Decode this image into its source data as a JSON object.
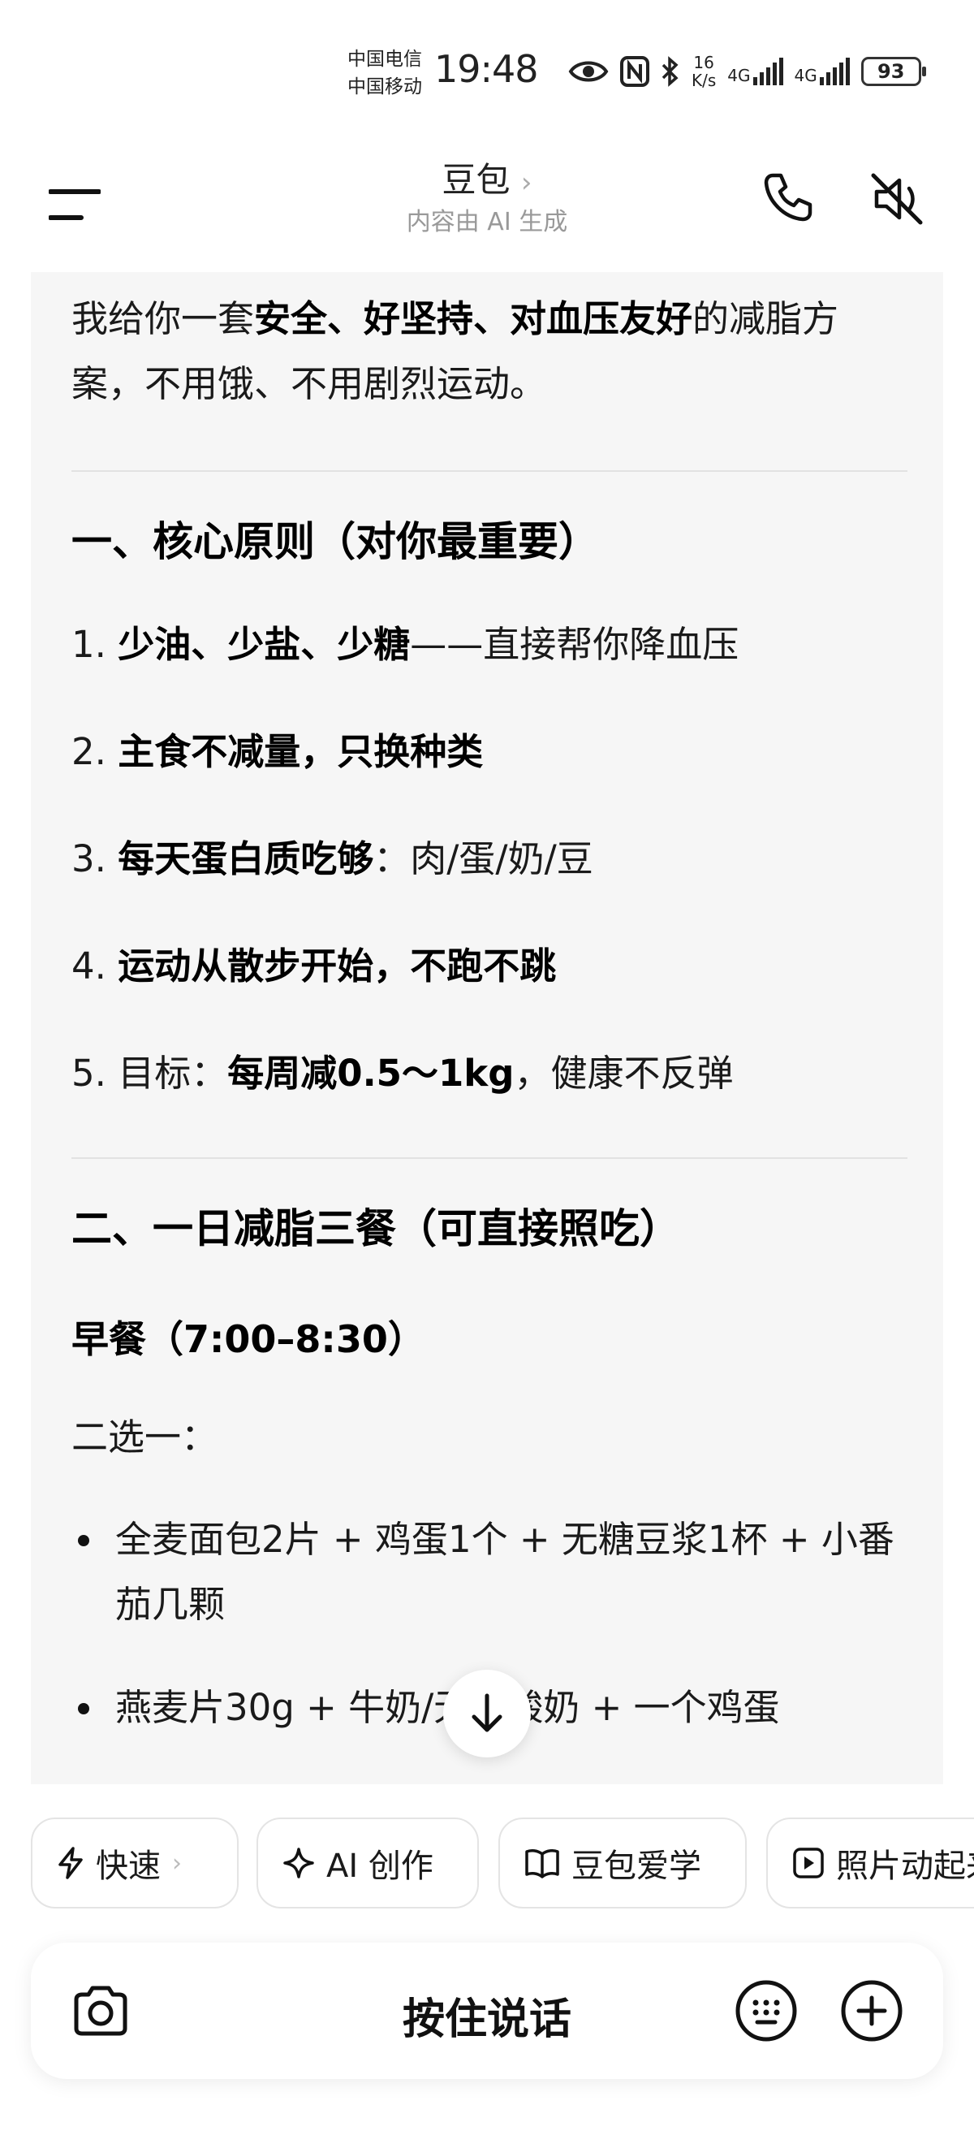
{
  "status_bar": {
    "carrier_1": "中国电信",
    "carrier_2": "中国移动",
    "time": "19:48",
    "speed_value": "16",
    "speed_unit": "K/s",
    "sim1_network": "4G",
    "sim2_network": "4G",
    "battery": "93"
  },
  "header": {
    "title": "豆包",
    "title_chevron": "›",
    "subtitle": "内容由 AI 生成"
  },
  "message": {
    "intro_a": "我给你一套",
    "intro_b": "安全、好坚持、对血压友好",
    "intro_c": "的减脂方案，不用饿、不用剧烈运动。",
    "section1_title": "一、核心原则（对你最重要）",
    "principles": [
      {
        "num": "1. ",
        "bold": "少油、少盐、少糖",
        "rest": "——直接帮你降血压"
      },
      {
        "num": "2. ",
        "bold": "主食不减量，只换种类",
        "rest": ""
      },
      {
        "num": "3. ",
        "bold": "每天蛋白质吃够",
        "rest": "：肉/蛋/奶/豆"
      },
      {
        "num": "4. ",
        "bold": "运动从散步开始，不跑不跳",
        "rest": ""
      },
      {
        "num": "5. ",
        "pre": "目标：",
        "bold": "每周减0.5～1kg",
        "rest": "，健康不反弹"
      }
    ],
    "section2_title": "二、一日减脂三餐（可直接照吃）",
    "breakfast_title": "早餐（7:00–8:30）",
    "choose_one": "二选一：",
    "options": [
      "全麦面包2片 + 鸡蛋1个 + 无糖豆浆1杯 + 小番茄几颗",
      "燕麦片30g + 牛奶/无糖酸奶 + 一个鸡蛋"
    ]
  },
  "chips": [
    {
      "label": "快速",
      "icon": "lightning-icon",
      "chevron": "›"
    },
    {
      "label": "AI 创作",
      "icon": "sparkle-icon"
    },
    {
      "label": "豆包爱学",
      "icon": "book-icon"
    },
    {
      "label": "照片动起来",
      "icon": "play-icon"
    }
  ],
  "input_bar": {
    "hold_to_talk": "按住说话"
  }
}
